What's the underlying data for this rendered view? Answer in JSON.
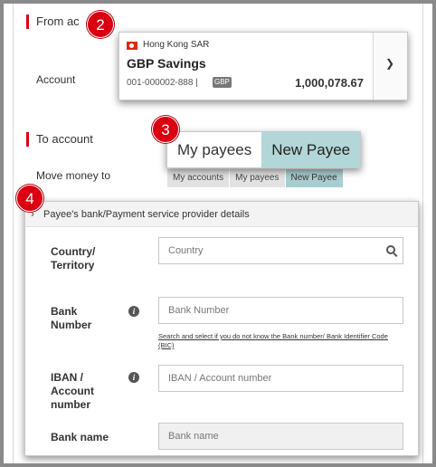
{
  "from_section": {
    "title": "From ac",
    "account_label": "Account"
  },
  "account_card": {
    "region": "Hong Kong SAR",
    "name": "GBP Savings",
    "number": "001-000002-888 |",
    "currency_tag": "GBP",
    "balance": "1,000,078.67",
    "expand_icon": "chevron-down-icon"
  },
  "to_section": {
    "title": "To account",
    "move_money_label": "Move money to"
  },
  "tabs_small": [
    "My accounts",
    "My payees",
    "New Payee"
  ],
  "tabs_big": [
    "My payees",
    "New Payee"
  ],
  "badges": [
    "2",
    "3",
    "4"
  ],
  "payee_panel": {
    "header": "Payee's bank/Payment service provider details",
    "country": {
      "label": "Country/\nTerritory",
      "placeholder": "Country"
    },
    "bank_number": {
      "label": "Bank\nNumber",
      "placeholder": "Bank Number",
      "help_link": "Search and select if you do not know the Bank number/ Bank Identifier Code (BIC)"
    },
    "iban": {
      "label": "IBAN /\nAccount\nnumber",
      "placeholder": "IBAN / Account number"
    },
    "bank_name": {
      "label": "Bank name",
      "placeholder": "Bank name"
    }
  },
  "colors": {
    "accent_red": "#db0011",
    "tab_active": "#b3d6d8"
  }
}
